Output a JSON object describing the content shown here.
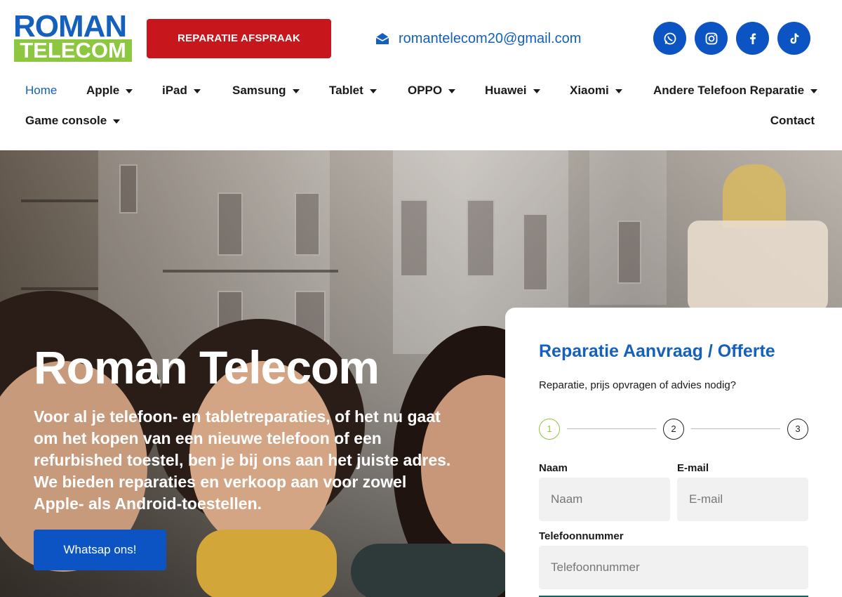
{
  "logo": {
    "line1": "ROMAN",
    "line2": "TELECOM"
  },
  "header": {
    "cta_label": "REPARATIE AFSPRAAK",
    "email": "romantelecom20@gmail.com",
    "socials": [
      "whatsapp-icon",
      "instagram-icon",
      "facebook-icon",
      "tiktok-icon"
    ]
  },
  "nav": {
    "items": [
      {
        "label": "Home"
      },
      {
        "label": "Apple"
      },
      {
        "label": "iPad"
      },
      {
        "label": "Samsung"
      },
      {
        "label": "Tablet"
      },
      {
        "label": "OPPO"
      },
      {
        "label": "Huawei"
      },
      {
        "label": "Xiaomi"
      },
      {
        "label": "Andere Telefoon Reparatie"
      },
      {
        "label": "Game console"
      },
      {
        "label": "Contact"
      }
    ]
  },
  "hero": {
    "title": "Roman Telecom",
    "text": "Voor al je telefoon- en tabletreparaties, of het nu gaat om het kopen van een nieuwe telefoon of een refurbished toestel, ben je bij ons aan het juiste adres. We bieden reparaties en verkoop aan voor zowel Apple- als Android-toestellen.",
    "button_label": "Whatsap ons!"
  },
  "form": {
    "title": "Reparatie Aanvraag / Offerte",
    "subtitle": "Reparatie, prijs opvragen of advies nodig?",
    "steps": [
      "1",
      "2",
      "3"
    ],
    "active_step": 1,
    "name_label": "Naam",
    "name_placeholder": "Naam",
    "email_label": "E-mail",
    "email_placeholder": "E-mail",
    "phone_label": "Telefoonnummer",
    "phone_placeholder": "Telefoonnummer"
  },
  "colors": {
    "brand_blue": "#1560bd",
    "button_blue": "#0c54c4",
    "cta_red": "#c8161d",
    "logo_green": "#8dc63f"
  }
}
